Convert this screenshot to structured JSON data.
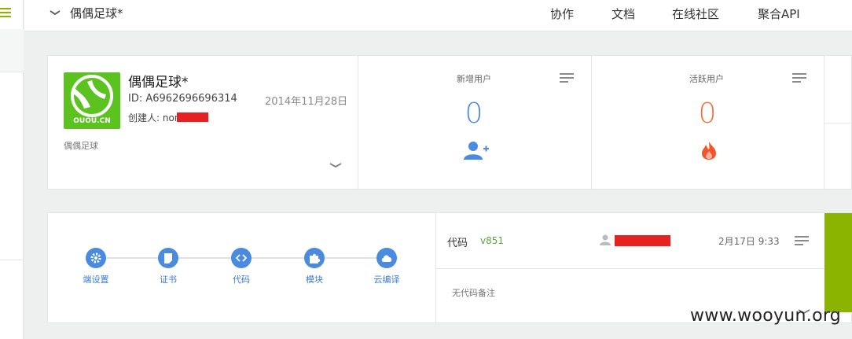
{
  "topbar": {
    "app_title": "偶偶足球*",
    "nav": [
      "协作",
      "文档",
      "在线社区",
      "聚合API"
    ]
  },
  "app_card": {
    "logo_text": "OUOU.CN",
    "name": "偶偶足球*",
    "id_text": "ID: A6962696696314",
    "created_date": "2014年11月28日",
    "creator_prefix": "创建人: nor",
    "description": "偶偶足球"
  },
  "stats": [
    {
      "label": "新增用户",
      "value": "0",
      "color": "#4a8be0",
      "icon": "add-user-icon"
    },
    {
      "label": "活跃用户",
      "value": "0",
      "color": "#f2733a",
      "icon": "fire-icon"
    }
  ],
  "steps": [
    {
      "label": "端设置",
      "icon": "gear-icon"
    },
    {
      "label": "证书",
      "icon": "certificate-icon"
    },
    {
      "label": "代码",
      "icon": "code-icon"
    },
    {
      "label": "模块",
      "icon": "puzzle-icon"
    },
    {
      "label": "云编译",
      "icon": "cloud-icon"
    }
  ],
  "code_panel": {
    "label": "代码",
    "version": "v851",
    "date": "2月17日 9:33",
    "note": "无代码备注"
  },
  "watermark": "www.wooyun.org",
  "colors": {
    "accent_green": "#8ab400",
    "primary_blue": "#4a8be0",
    "orange": "#f2733a",
    "redaction": "#e52121"
  }
}
